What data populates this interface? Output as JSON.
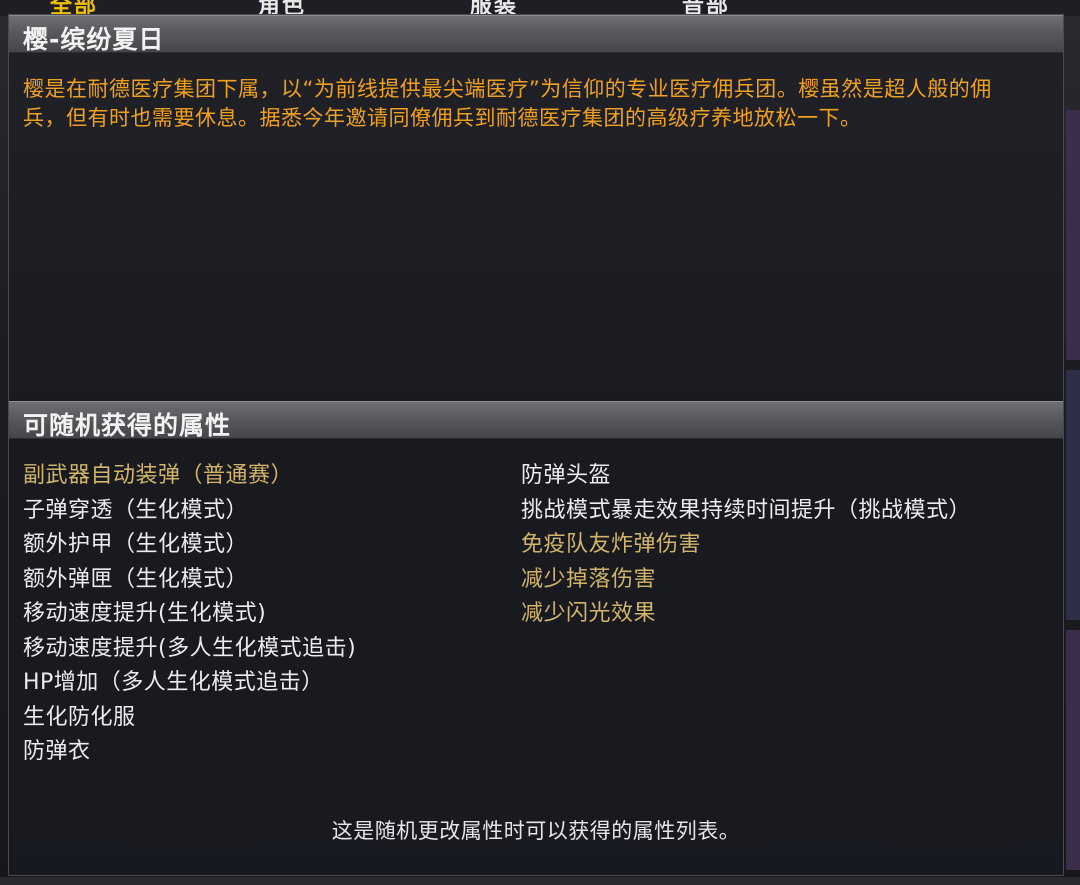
{
  "top_tabs": [
    {
      "label": "全部",
      "active": true
    },
    {
      "label": "角色",
      "active": false
    },
    {
      "label": "服装",
      "active": false
    },
    {
      "label": "音部",
      "active": false
    }
  ],
  "item": {
    "title": "樱-缤纷夏日",
    "description": "樱是在耐德医疗集团下属，以“为前线提供最尖端医疗”为信仰的专业医疗佣兵团。樱虽然是超人般的佣兵，但有时也需要休息。据悉今年邀请同僚佣兵到耐德医疗集团的高级疗养地放松一下。"
  },
  "attributes": {
    "header": "可随机获得的属性",
    "left": [
      {
        "label": "副武器自动装弹（普通赛）",
        "color": "gold"
      },
      {
        "label": "子弹穿透（生化模式）",
        "color": "white"
      },
      {
        "label": "额外护甲（生化模式）",
        "color": "white"
      },
      {
        "label": "额外弹匣（生化模式）",
        "color": "white"
      },
      {
        "label": "移动速度提升(生化模式)",
        "color": "white"
      },
      {
        "label": "移动速度提升(多人生化模式追击)",
        "color": "white"
      },
      {
        "label": "HP增加（多人生化模式追击）",
        "color": "white"
      },
      {
        "label": "生化防化服",
        "color": "white"
      },
      {
        "label": "防弹衣",
        "color": "white"
      }
    ],
    "right": [
      {
        "label": "防弹头盔",
        "color": "white"
      },
      {
        "label": "挑战模式暴走效果持续时间提升（挑战模式）",
        "color": "white"
      },
      {
        "label": "免疫队友炸弹伤害",
        "color": "gold"
      },
      {
        "label": "减少掉落伤害",
        "color": "gold"
      },
      {
        "label": "减少闪光效果",
        "color": "gold"
      }
    ]
  },
  "footer_note": "这是随机更改属性时可以获得的属性列表。",
  "colors": {
    "gold": "#d2b46a",
    "white": "#ececec",
    "description": "#f0a020",
    "tab_active": "#f0c000"
  }
}
